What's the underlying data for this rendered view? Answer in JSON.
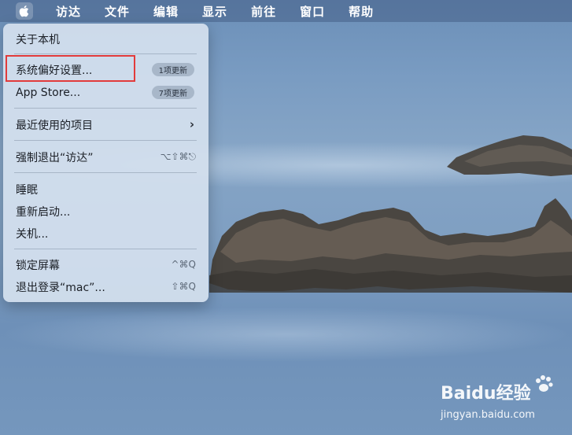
{
  "menubar": {
    "apple_icon": "apple-logo-icon",
    "items": [
      "访达",
      "文件",
      "编辑",
      "显示",
      "前往",
      "窗口",
      "帮助"
    ]
  },
  "apple_menu": {
    "about": "关于本机",
    "system_prefs": "系统偏好设置...",
    "system_prefs_badge": "1项更新",
    "app_store": "App Store...",
    "app_store_badge": "7项更新",
    "recent_items": "最近使用的项目",
    "force_quit": "强制退出“访达”",
    "force_quit_shortcut": "⌥⇧⌘⎋",
    "sleep": "睡眠",
    "restart": "重新启动...",
    "shutdown": "关机...",
    "lock_screen": "锁定屏幕",
    "lock_screen_shortcut": "^⌘Q",
    "logout": "退出登录“mac”...",
    "logout_shortcut": "⇧⌘Q"
  },
  "watermark": {
    "brand": "Baidu经验",
    "url": "jingyan.baidu.com"
  },
  "colors": {
    "highlight_border": "#e23b3b",
    "menu_bg": "#d4e0ee"
  }
}
